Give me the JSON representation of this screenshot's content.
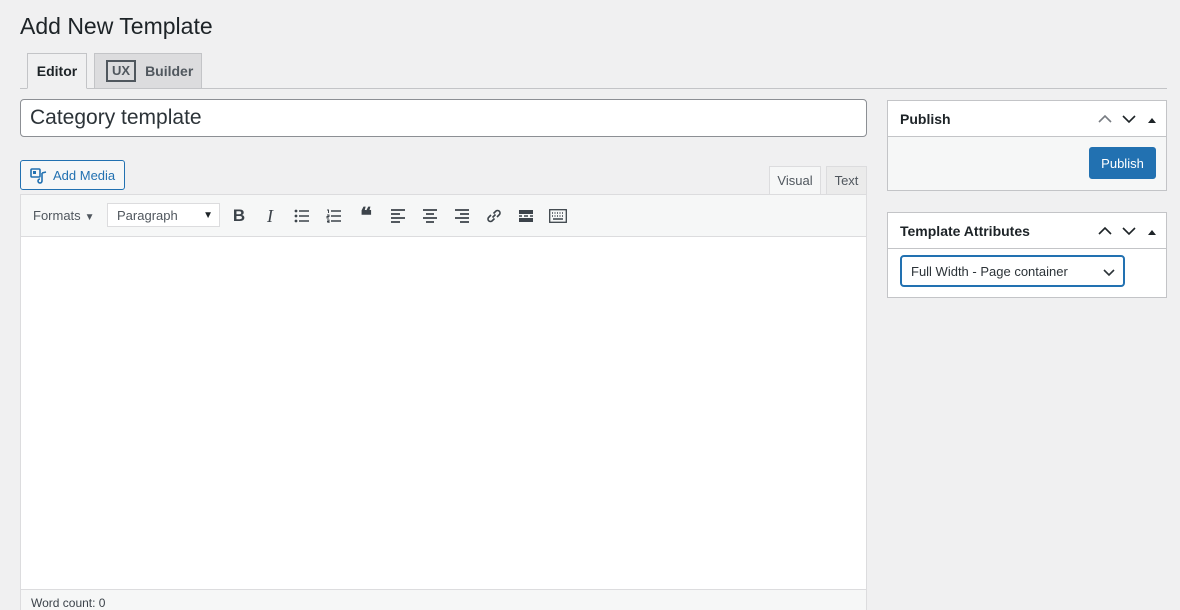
{
  "page": {
    "title": "Add New Template"
  },
  "tabs": {
    "editor": "Editor",
    "builder_badge": "UX",
    "builder": "Builder"
  },
  "post": {
    "title": "Category template"
  },
  "media": {
    "add_label": "Add Media"
  },
  "editor_modes": {
    "visual": "Visual",
    "text": "Text"
  },
  "toolbar": {
    "formats_label": "Formats",
    "paragraph_value": "Paragraph",
    "buttons": [
      "bold-icon",
      "italic-icon",
      "bullet-list-icon",
      "numbered-list-icon",
      "blockquote-icon",
      "align-left-icon",
      "align-center-icon",
      "align-right-icon",
      "link-icon",
      "read-more-icon",
      "toolbar-toggle-icon"
    ]
  },
  "status": {
    "word_count": "Word count: 0"
  },
  "publish": {
    "heading": "Publish",
    "button": "Publish"
  },
  "template_attributes": {
    "heading": "Template Attributes",
    "selected": "Full Width - Page container"
  },
  "colors": {
    "accent": "#2271b1",
    "background": "#f0f0f1",
    "border": "#c3c4c7"
  }
}
